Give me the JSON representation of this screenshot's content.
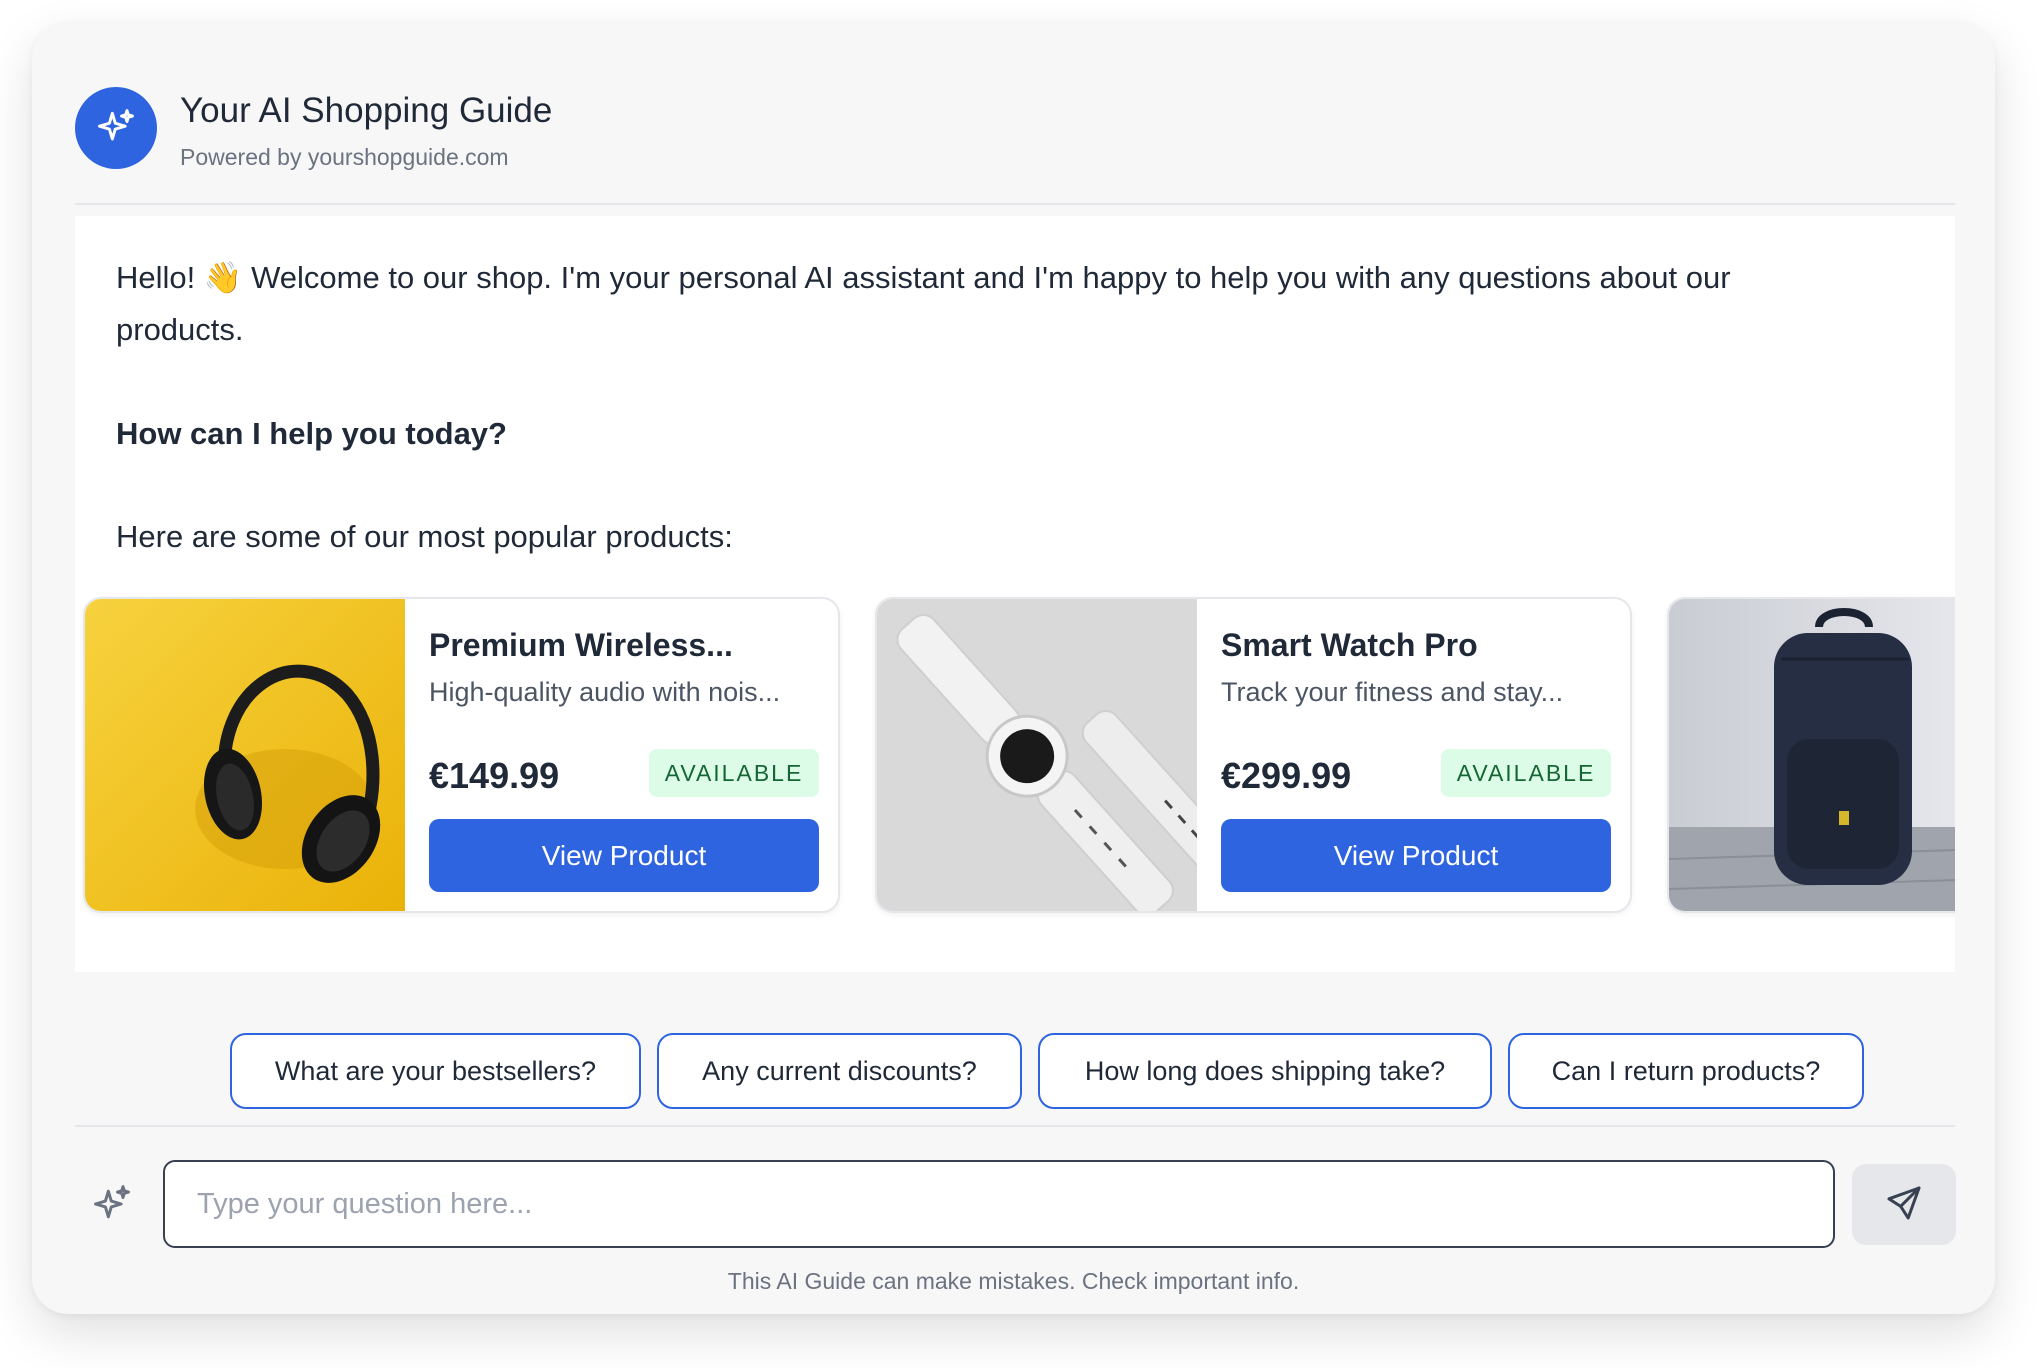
{
  "header": {
    "title": "Your AI Shopping Guide",
    "subtitle": "Powered by yourshopguide.com",
    "logo_icon": "sparkles-icon"
  },
  "message": {
    "line1": "Hello! 👋 Welcome to our shop. I'm your personal AI assistant and I'm happy to help you with any questions about our",
    "line2": "products.",
    "question": "How can I help you today?",
    "line3": "Here are some of our most popular products:"
  },
  "products": [
    {
      "name": "Premium Wireless...",
      "description": "High-quality audio with nois...",
      "price": "€149.99",
      "badge": "AVAILABLE",
      "button": "View Product"
    },
    {
      "name": "Smart Watch Pro",
      "description": "Track your fitness and stay...",
      "price": "€299.99",
      "badge": "AVAILABLE",
      "button": "View Product"
    }
  ],
  "suggestions": [
    "What are your bestsellers?",
    "Any current discounts?",
    "How long does shipping take?",
    "Can I return products?"
  ],
  "input": {
    "placeholder": "Type your question here..."
  },
  "disclaimer": "This AI Guide can make mistakes. Check important info.",
  "colors": {
    "accent": "#2e64e0",
    "badge_bg": "#dcfce7",
    "badge_text": "#166534"
  }
}
